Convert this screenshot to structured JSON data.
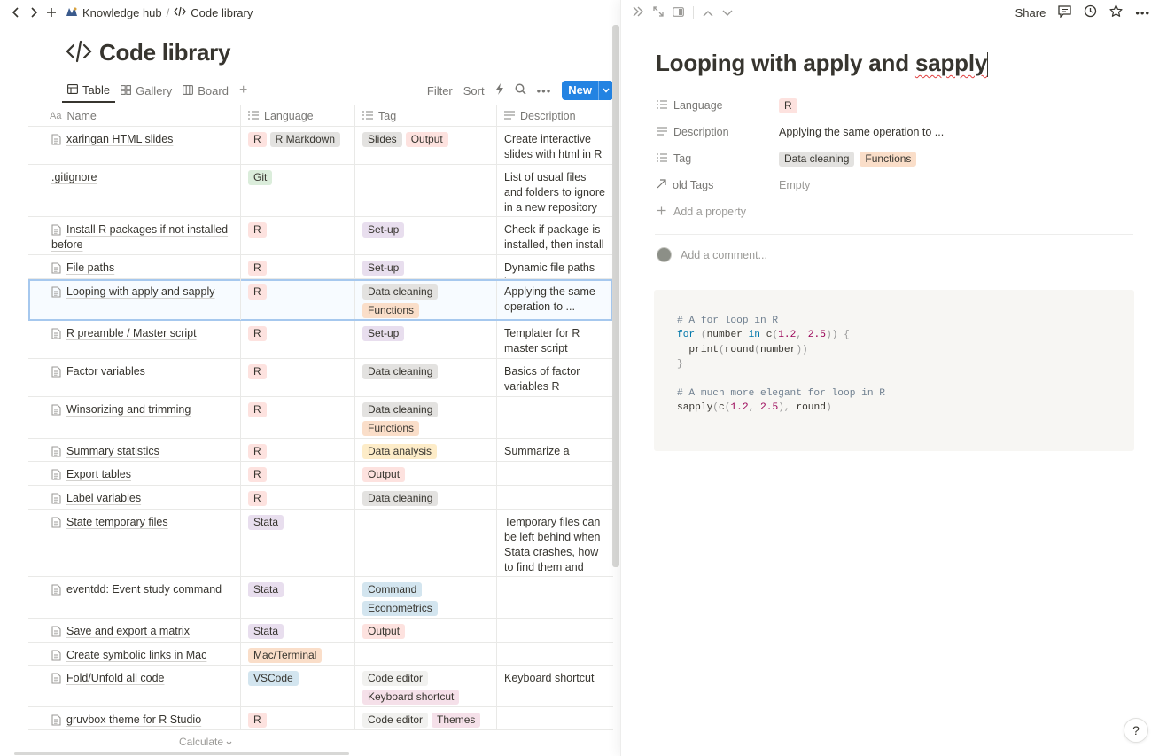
{
  "breadcrumb": {
    "workspace": "Knowledge hub",
    "separator": "/",
    "page": "Code library"
  },
  "page": {
    "title": "Code library"
  },
  "views": [
    {
      "label": "Table",
      "icon": "table-icon",
      "active": true
    },
    {
      "label": "Gallery",
      "icon": "gallery-icon",
      "active": false
    },
    {
      "label": "Board",
      "icon": "board-icon",
      "active": false
    }
  ],
  "toolbar": {
    "filter": "Filter",
    "sort": "Sort",
    "new": "New"
  },
  "columns": {
    "name": "Name",
    "language": "Language",
    "tag": "Tag",
    "description": "Description",
    "name_prefix": "Aa"
  },
  "tag_colors": {
    "R": "#fde2df",
    "R Markdown": "#e3e2e0",
    "Git": "#dbeddb",
    "Stata": "#e8deee",
    "Mac/Terminal": "#fadec9",
    "VSCode": "#d3e5ef",
    "Slides": "#e3e2e0",
    "Output": "#fde2df",
    "Set-up": "#e8deee",
    "Data cleaning": "#e3e2e0",
    "Functions": "#fadec9",
    "Data analysis": "#fdecc8",
    "Command": "#d3e5ef",
    "Econometrics": "#d3e5ef",
    "Code editor": "#f1f1ef",
    "Keyboard shortcut": "#f5e0e9",
    "Themes": "#f5e0e9"
  },
  "rows": [
    {
      "name": "xaringan HTML slides",
      "icon": true,
      "language": [
        "R",
        "R Markdown"
      ],
      "tags": [
        "Slides",
        "Output"
      ],
      "description": "Create interactive slides with html in R Markdown",
      "height": 43
    },
    {
      "name": ".gitignore",
      "icon": false,
      "language": [
        "Git"
      ],
      "tags": [],
      "description": "List of usual files and folders to ignore in a new repository",
      "height": 59
    },
    {
      "name": "Install R packages if not installed before",
      "icon": true,
      "language": [
        "R"
      ],
      "tags": [
        "Set-up"
      ],
      "description": "Check if package is installed, then install it",
      "height": 43
    },
    {
      "name": "File paths",
      "icon": true,
      "language": [
        "R"
      ],
      "tags": [
        "Set-up"
      ],
      "description": "Dynamic file paths in R",
      "height": 27
    },
    {
      "name": "Looping with apply and sapply",
      "icon": true,
      "language": [
        "R"
      ],
      "tags": [
        "Data cleaning",
        "Functions"
      ],
      "description": "Applying the same operation to ...",
      "height": 47,
      "selected": true
    },
    {
      "name": "R preamble / Master script",
      "icon": true,
      "language": [
        "R"
      ],
      "tags": [
        "Set-up"
      ],
      "description": "Templater for R master script",
      "height": 43
    },
    {
      "name": "Factor variables",
      "icon": true,
      "language": [
        "R"
      ],
      "tags": [
        "Data cleaning"
      ],
      "description": "Basics of factor variables R",
      "height": 43
    },
    {
      "name": "Winsorizing and trimming",
      "icon": true,
      "language": [
        "R"
      ],
      "tags": [
        "Data cleaning",
        "Functions"
      ],
      "description": "",
      "height": 47
    },
    {
      "name": "Summary statistics",
      "icon": true,
      "language": [
        "R"
      ],
      "tags": [
        "Data analysis"
      ],
      "description": "Summarize a variable",
      "height": 26
    },
    {
      "name": "Export tables",
      "icon": true,
      "language": [
        "R"
      ],
      "tags": [
        "Output"
      ],
      "description": "",
      "height": 27
    },
    {
      "name": "Label variables",
      "icon": true,
      "language": [
        "R"
      ],
      "tags": [
        "Data cleaning"
      ],
      "description": "",
      "height": 27
    },
    {
      "name": "State temporary files",
      "icon": true,
      "language": [
        "Stata"
      ],
      "tags": [],
      "description": "Temporary files can be left behind when Stata crashes, how to find them and delete them",
      "height": 76
    },
    {
      "name": "eventdd: Event study command",
      "icon": true,
      "language": [
        "Stata"
      ],
      "tags": [
        "Command",
        "Econometrics"
      ],
      "description": "",
      "height": 47
    },
    {
      "name": "Save and export a matrix",
      "icon": true,
      "language": [
        "Stata"
      ],
      "tags": [
        "Output"
      ],
      "description": "",
      "height": 27
    },
    {
      "name": "Create symbolic links in Mac",
      "icon": true,
      "language": [
        "Mac/Terminal"
      ],
      "tags": [],
      "description": "",
      "height": 26
    },
    {
      "name": "Fold/Unfold all code",
      "icon": true,
      "language": [
        "VSCode"
      ],
      "tags": [
        "Code editor",
        "Keyboard shortcut"
      ],
      "description": "Keyboard shortcut",
      "height": 47
    },
    {
      "name": "gruvbox theme for R Studio",
      "icon": true,
      "language": [
        "R"
      ],
      "tags": [
        "Code editor",
        "Themes"
      ],
      "description": "",
      "height": 26
    }
  ],
  "footer": {
    "calculate": "Calculate"
  },
  "detail": {
    "share": "Share",
    "title_plain": "Looping with apply and ",
    "title_flagged": "sapply",
    "properties": [
      {
        "label": "Language",
        "icon": "list-icon",
        "chips": [
          "R"
        ]
      },
      {
        "label": "Description",
        "icon": "text-icon",
        "text": "Applying the same operation to ..."
      },
      {
        "label": "Tag",
        "icon": "list-icon",
        "chips": [
          "Data cleaning",
          "Functions"
        ]
      },
      {
        "label": "old Tags",
        "icon": "arrow-up-right-icon",
        "empty": "Empty"
      }
    ],
    "add_property": "Add a property",
    "comment_placeholder": "Add a comment...",
    "code_lines": [
      "# A for loop in R",
      "for (number in c(1.2, 2.5)) {",
      "  print(round(number))",
      "}",
      "",
      "# A much more elegant for loop in R",
      "sapply(c(1.2, 2.5), round)"
    ]
  },
  "help": "?"
}
